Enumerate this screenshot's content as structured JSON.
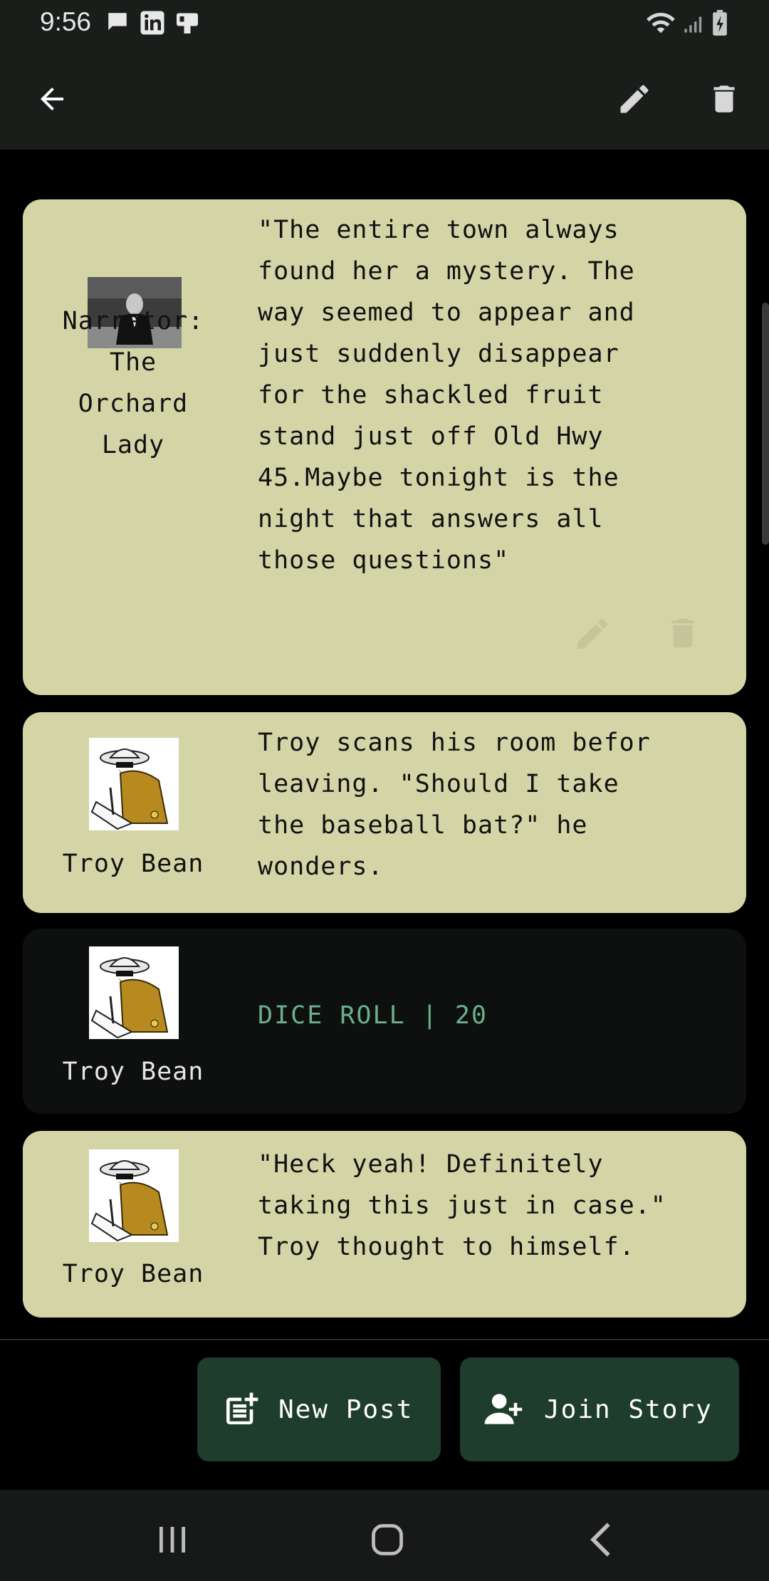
{
  "status_bar": {
    "time": "9:56",
    "icons": [
      "message-icon",
      "linkedin-icon",
      "cast-icon",
      "wifi-icon",
      "signal-icon",
      "battery-charging-icon"
    ]
  },
  "app_bar": {
    "back_icon": "arrow-left-icon",
    "edit_icon": "pencil-icon",
    "delete_icon": "trash-icon"
  },
  "posts": [
    {
      "author": "Narrator:\nThe\nOrchard\nLady",
      "text": "\"The entire town always\nfound her a mystery. The\nway seemed to appear and\njust suddenly disappear\nfor the shackled fruit\nstand just off Old Hwy\n45.Maybe tonight is the\nnight that answers all\nthose questions\"",
      "has_actions": true
    },
    {
      "author": "Troy Bean",
      "text": "Troy scans his room befor\nleaving. \"Should I take\nthe baseball bat?\" he\nwonders."
    },
    {
      "author": "Troy Bean",
      "dice": "DICE ROLL | 20"
    },
    {
      "author": "Troy Bean",
      "text": "\"Heck yeah! Definitely\ntaking this just in case.\"\nTroy thought to himself."
    }
  ],
  "buttons": {
    "new_post": "New Post",
    "join_story": "Join Story"
  },
  "colors": {
    "card_light": "#d4d5a7",
    "card_dark": "#0e0f0f",
    "button_bg": "#1f3d2c",
    "dice_text": "#6ab08c",
    "app_bar": "#1a1e1b"
  }
}
